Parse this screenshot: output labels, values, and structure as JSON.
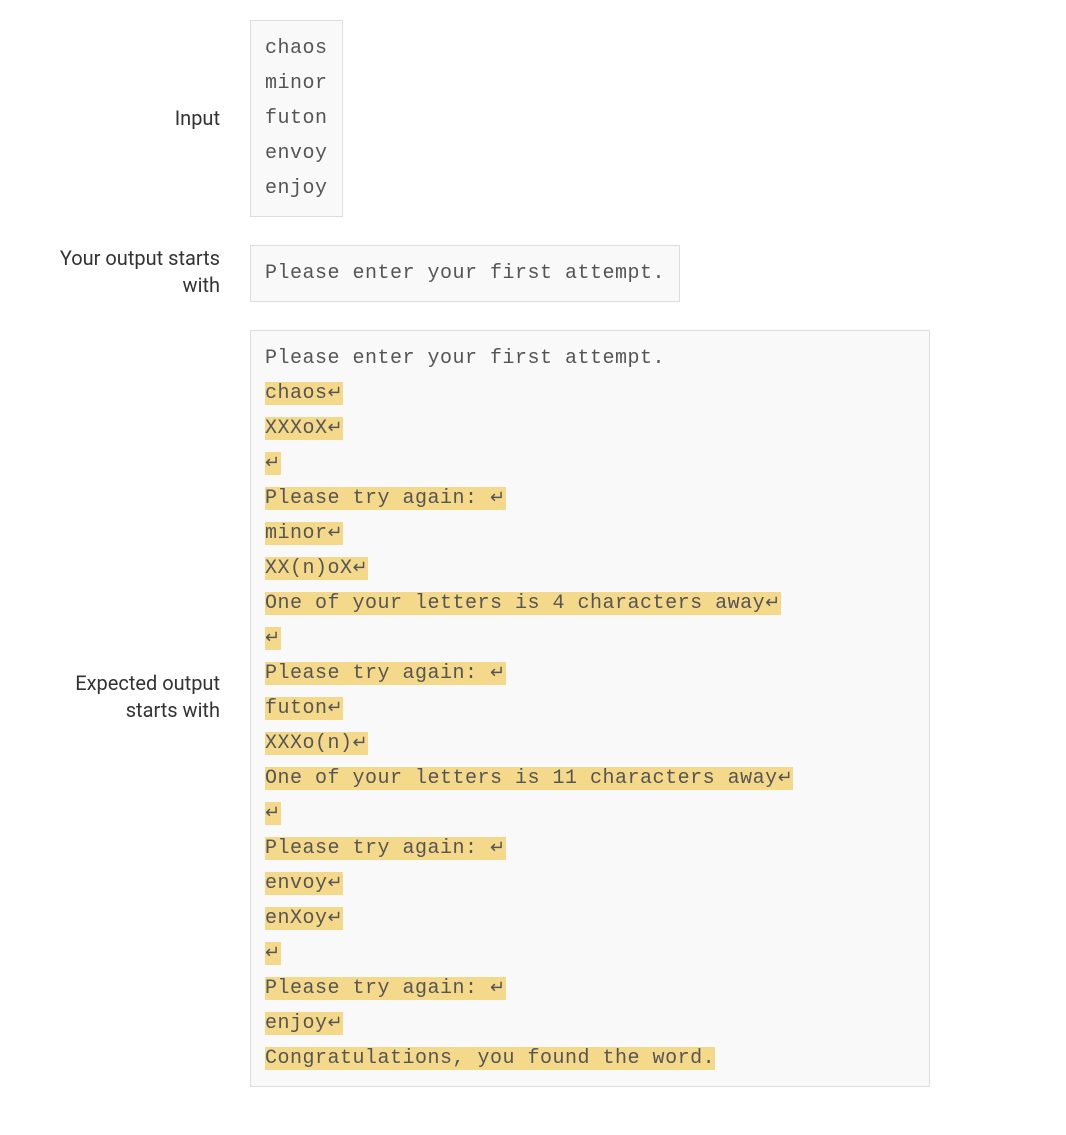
{
  "labels": {
    "input": "Input",
    "your_output": "Your output starts with",
    "expected_output": "Expected output starts with"
  },
  "input_lines": [
    "chaos",
    "minor",
    "futon",
    "envoy",
    "enjoy"
  ],
  "your_output": "Please enter your first attempt.",
  "expected": {
    "plain_first": "Please enter your first attempt.",
    "l_chaos": "chaos",
    "l_xxxox": "XXXoX",
    "l_try1": "Please try again: ",
    "l_minor": "minor",
    "l_xxnox": "XX(n)oX",
    "l_away4": "One of your letters is 4 characters away",
    "l_try2": "Please try again: ",
    "l_futon": "futon",
    "l_xxxon": "XXXo(n)",
    "l_away11": "One of your letters is 11 characters away",
    "l_try3": "Please try again: ",
    "l_envoy": "envoy",
    "l_enxoy": "enXoy",
    "l_try4": "Please try again: ",
    "l_enjoy": "enjoy",
    "l_congrats": "Congratulations, you found the word."
  }
}
